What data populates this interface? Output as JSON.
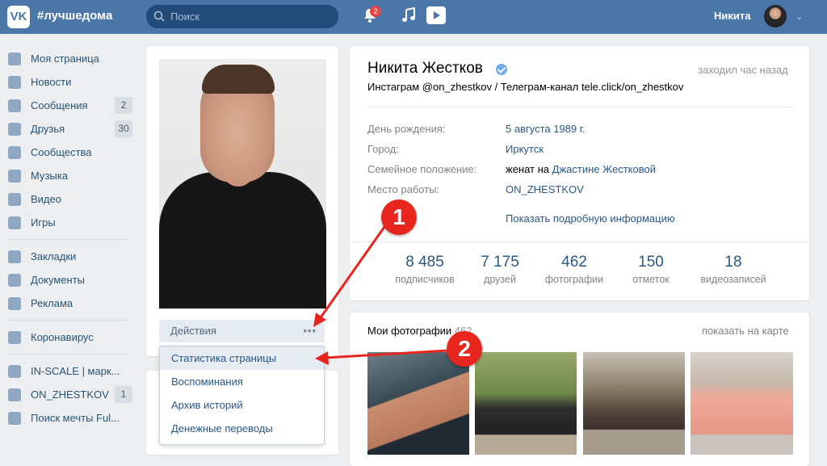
{
  "header": {
    "logo": "VK",
    "brand": "#лучшедома",
    "search_placeholder": "Поиск",
    "notifications_badge": "2",
    "user_name": "Никита"
  },
  "sidebar": {
    "items": [
      {
        "label": "Моя страница",
        "icon": "home-icon"
      },
      {
        "label": "Новости",
        "icon": "news-icon"
      },
      {
        "label": "Сообщения",
        "icon": "messages-icon",
        "count": "2"
      },
      {
        "label": "Друзья",
        "icon": "friends-icon",
        "count": "30"
      },
      {
        "label": "Сообщества",
        "icon": "groups-icon"
      },
      {
        "label": "Музыка",
        "icon": "music-icon"
      },
      {
        "label": "Видео",
        "icon": "video-icon"
      },
      {
        "label": "Игры",
        "icon": "games-icon"
      },
      {
        "label": "Закладки",
        "icon": "star-icon"
      },
      {
        "label": "Документы",
        "icon": "document-icon"
      },
      {
        "label": "Реклама",
        "icon": "ads-icon"
      },
      {
        "label": "Коронавирус",
        "icon": "virus-icon"
      },
      {
        "label": "IN-SCALE | марк...",
        "icon": "group-icon"
      },
      {
        "label": "ON_ZHESTKOV",
        "icon": "group-icon",
        "count": "1"
      },
      {
        "label": "Поиск мечты Ful...",
        "icon": "group-icon"
      }
    ]
  },
  "actions": {
    "label": "Действия",
    "menu": [
      "Статистика страницы",
      "Воспоминания",
      "Архив историй",
      "Денежные переводы"
    ]
  },
  "profile": {
    "name": "Никита Жестков",
    "last_seen": "заходил час назад",
    "status": "Инстаграм @on_zhestkov / Телеграм-канал tele.click/on_zhestkov",
    "info": [
      {
        "label": "День рождения:",
        "value": "5 августа 1989 г."
      },
      {
        "label": "Город:",
        "value": "Иркутск"
      },
      {
        "label": "Семейное положение:",
        "value_prefix": "женат на",
        "value": "Джастине Жестковой"
      },
      {
        "label": "Место работы:",
        "value": "ON_ZHESTKOV"
      }
    ],
    "more_info": "Показать подробную информацию",
    "stats": [
      {
        "n": "8 485",
        "l": "подписчиков"
      },
      {
        "n": "7 175",
        "l": "друзей"
      },
      {
        "n": "462",
        "l": "фотографии"
      },
      {
        "n": "150",
        "l": "отметок"
      },
      {
        "n": "18",
        "l": "видеозаписей"
      }
    ]
  },
  "photos": {
    "title": "Мои фотографии",
    "count": "462",
    "on_map": "показать на карте"
  },
  "annotations": {
    "one": "1",
    "two": "2"
  }
}
